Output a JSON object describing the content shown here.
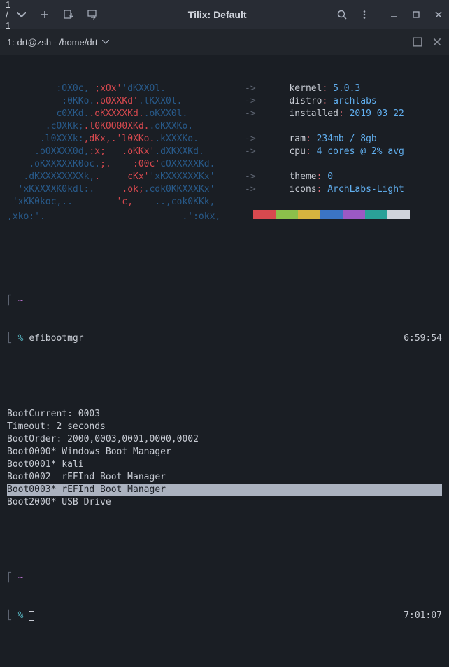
{
  "titlebar": {
    "tab_counter": "1 / 1",
    "title": "Tilix: Default"
  },
  "tabbar": {
    "label": "1: drt@zsh - /home/drt"
  },
  "ascii_logo": [
    {
      "segs": [
        {
          "t": "         ",
          "c": ""
        },
        {
          "t": ":OX0c, ",
          "c": "c-dblue"
        },
        {
          "t": ";xOx'",
          "c": "c-red"
        },
        {
          "t": "'dKXX0l.           ",
          "c": "c-dblue"
        }
      ]
    },
    {
      "segs": [
        {
          "t": "          ",
          "c": ""
        },
        {
          "t": ":0KKo.",
          "c": "c-dblue"
        },
        {
          "t": ".o0XXKd'",
          "c": "c-red"
        },
        {
          "t": ".lKXX0l.          ",
          "c": "c-dblue"
        }
      ]
    },
    {
      "segs": [
        {
          "t": "         ",
          "c": ""
        },
        {
          "t": "c0XKd.",
          "c": "c-dblue"
        },
        {
          "t": ".oKXXXXKd.",
          "c": "c-red"
        },
        {
          "t": ".oKXX0l.         ",
          "c": "c-dblue"
        }
      ]
    },
    {
      "segs": [
        {
          "t": "       ",
          "c": ""
        },
        {
          "t": ".c0XKk;",
          "c": "c-dblue"
        },
        {
          "t": ".l0K0O00XKd.",
          "c": "c-red"
        },
        {
          "t": ".oKXXKo.        ",
          "c": "c-dblue"
        }
      ]
    },
    {
      "segs": [
        {
          "t": "      ",
          "c": ""
        },
        {
          "t": ".l0XXXk:",
          "c": "c-dblue"
        },
        {
          "t": ",dKx,.'l0XKo.",
          "c": "c-red"
        },
        {
          "t": ".kXXXKo.       ",
          "c": "c-dblue"
        }
      ]
    },
    {
      "segs": [
        {
          "t": "     ",
          "c": ""
        },
        {
          "t": ".o0XXXX0d,",
          "c": "c-dblue"
        },
        {
          "t": ":x;   .oKKx'",
          "c": "c-red"
        },
        {
          "t": ".dXKXXKd.      ",
          "c": "c-dblue"
        }
      ]
    },
    {
      "segs": [
        {
          "t": "    ",
          "c": ""
        },
        {
          "t": ".oKXXXXXK0oc.",
          "c": "c-dblue"
        },
        {
          "t": ";.    :00c'",
          "c": "c-red"
        },
        {
          "t": "cOXXXXXKd.     ",
          "c": "c-dblue"
        }
      ]
    },
    {
      "segs": [
        {
          "t": "   ",
          "c": ""
        },
        {
          "t": ".dKXXXXXXXXk,",
          "c": "c-dblue"
        },
        {
          "t": ".     cKx'",
          "c": "c-red"
        },
        {
          "t": "'xKXXXXXXKx'    ",
          "c": "c-dblue"
        }
      ]
    },
    {
      "segs": [
        {
          "t": "  ",
          "c": ""
        },
        {
          "t": "'xKXXXXK0kdl:.",
          "c": "c-dblue"
        },
        {
          "t": "     .ok;",
          "c": "c-red"
        },
        {
          "t": ".cdk0KKXXXKx'   ",
          "c": "c-dblue"
        }
      ]
    },
    {
      "segs": [
        {
          "t": " ",
          "c": ""
        },
        {
          "t": "'xKK0koc,..    ",
          "c": "c-dblue"
        },
        {
          "t": "    'c,    ",
          "c": "c-red"
        },
        {
          "t": "..,cok0KKk,  ",
          "c": "c-dblue"
        }
      ]
    },
    {
      "segs": [
        {
          "t": ",xko:'.                         .':okx,",
          "c": "c-dblue"
        }
      ]
    }
  ],
  "sysinfo": [
    {
      "label": "kernel",
      "value": "5.0.3"
    },
    {
      "label": "distro",
      "value": "archlabs"
    },
    {
      "label": "installed",
      "value": "2019 03 22"
    },
    null,
    {
      "label": "ram",
      "value": "234mb / 8gb"
    },
    {
      "label": "cpu",
      "value": "4 cores @ 2% avg"
    },
    null,
    {
      "label": "theme",
      "value": "0"
    },
    {
      "label": "icons",
      "value": "ArchLabs-Light"
    }
  ],
  "swatches": [
    "#d8494f",
    "#8cc04b",
    "#d5b33f",
    "#3b74c4",
    "#9b59c4",
    "#2aa198",
    "#d0d4dc"
  ],
  "prompt1": {
    "cmd": "efibootmgr",
    "time": "6:59:54"
  },
  "output": [
    {
      "text": "BootCurrent: 0003",
      "hl": false
    },
    {
      "text": "Timeout: 2 seconds",
      "hl": false
    },
    {
      "text": "BootOrder: 2000,0003,0001,0000,0002",
      "hl": false
    },
    {
      "text": "Boot0000* Windows Boot Manager",
      "hl": false
    },
    {
      "text": "Boot0001* kali",
      "hl": false
    },
    {
      "text": "Boot0002  rEFInd Boot Manager",
      "hl": false
    },
    {
      "text": "Boot0003* rEFInd Boot Manager",
      "hl": true
    },
    {
      "text": "Boot2000* USB Drive",
      "hl": false
    }
  ],
  "prompt2": {
    "time": "7:01:07"
  }
}
